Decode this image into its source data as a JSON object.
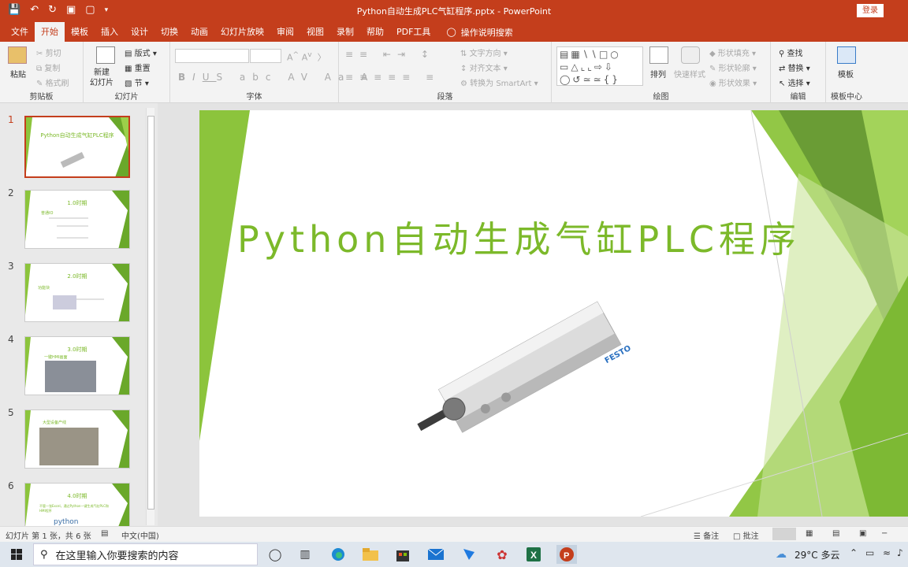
{
  "window": {
    "title": "Python自动生成PLC气缸程序.pptx  -  PowerPoint",
    "login": "登录"
  },
  "menu": {
    "tabs": [
      "文件",
      "开始",
      "模板",
      "插入",
      "设计",
      "切换",
      "动画",
      "幻灯片放映",
      "审阅",
      "视图",
      "录制",
      "帮助",
      "PDF工具"
    ],
    "active": "开始",
    "tell_me": "操作说明搜索"
  },
  "ribbon": {
    "clipboard": {
      "label": "剪贴板",
      "paste": "粘贴",
      "cut": "剪切",
      "copy": "复制",
      "format_painter": "格式刷"
    },
    "slides": {
      "label": "幻灯片",
      "new_slide": "新建\n幻灯片",
      "layout": "版式",
      "reset": "重置",
      "section": "节"
    },
    "font": {
      "label": "字体"
    },
    "paragraph": {
      "label": "段落",
      "text_direction": "文字方向",
      "align_text": "对齐文本",
      "smartart": "转换为 SmartArt"
    },
    "drawing": {
      "label": "绘图",
      "arrange": "排列",
      "quick_styles": "快速样式",
      "shape_fill": "形状填充",
      "shape_outline": "形状轮廓",
      "shape_effects": "形状效果"
    },
    "editing": {
      "label": "编辑",
      "find": "查找",
      "replace": "替换",
      "select": "选择"
    },
    "template_center": {
      "label": "模板中心",
      "template": "模板"
    }
  },
  "thumbnails": [
    {
      "num": "1",
      "title": "Python自动生成气缸PLC程序"
    },
    {
      "num": "2",
      "title": "1.0时期",
      "sub": "普通IO"
    },
    {
      "num": "3",
      "title": "2.0时期",
      "sub": "功能块"
    },
    {
      "num": "4",
      "title": "3.0时期",
      "sub": "一键HMI画面"
    },
    {
      "num": "5",
      "title": "",
      "sub": "大型设备产线"
    },
    {
      "num": "6",
      "title": "4.0时期",
      "sub": "不管一张Excel，通过Python一键生成气缸PLC和HMI程序",
      "extra": "python"
    }
  ],
  "slide": {
    "title": "Python自动生成气缸PLC程序",
    "brand": "FESTO",
    "accent": "#7cb92a"
  },
  "status": {
    "slide_info": "幻灯片 第 1 张，共 6 张",
    "language": "中文(中国)",
    "notes": "备注",
    "comments": "批注"
  },
  "taskbar": {
    "search_placeholder": "在这里输入你要搜索的内容",
    "weather": "29°C  多云"
  }
}
